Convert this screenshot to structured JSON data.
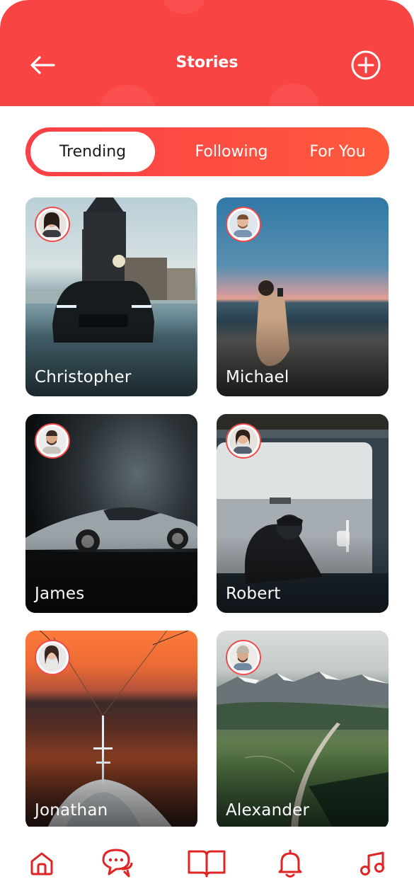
{
  "header": {
    "title": "Stories",
    "back_icon": "arrow-left-icon",
    "add_icon": "plus-circle-icon"
  },
  "tabs": [
    {
      "label": "Trending",
      "active": true
    },
    {
      "label": "Following",
      "active": false
    },
    {
      "label": "For You",
      "active": false
    }
  ],
  "stories": [
    {
      "name": "Christopher"
    },
    {
      "name": "Michael"
    },
    {
      "name": "James"
    },
    {
      "name": "Robert"
    },
    {
      "name": "Jonathan"
    },
    {
      "name": "Alexander"
    }
  ],
  "bottom_nav": [
    {
      "icon": "home-icon"
    },
    {
      "icon": "chat-icon"
    },
    {
      "icon": "book-icon"
    },
    {
      "icon": "bell-icon"
    },
    {
      "icon": "music-icon"
    }
  ],
  "colors": {
    "accent": "#f94444",
    "tab_gradient_start": "#fb3f47",
    "tab_gradient_end": "#ff5a3c",
    "nav_icon": "#e02424"
  }
}
